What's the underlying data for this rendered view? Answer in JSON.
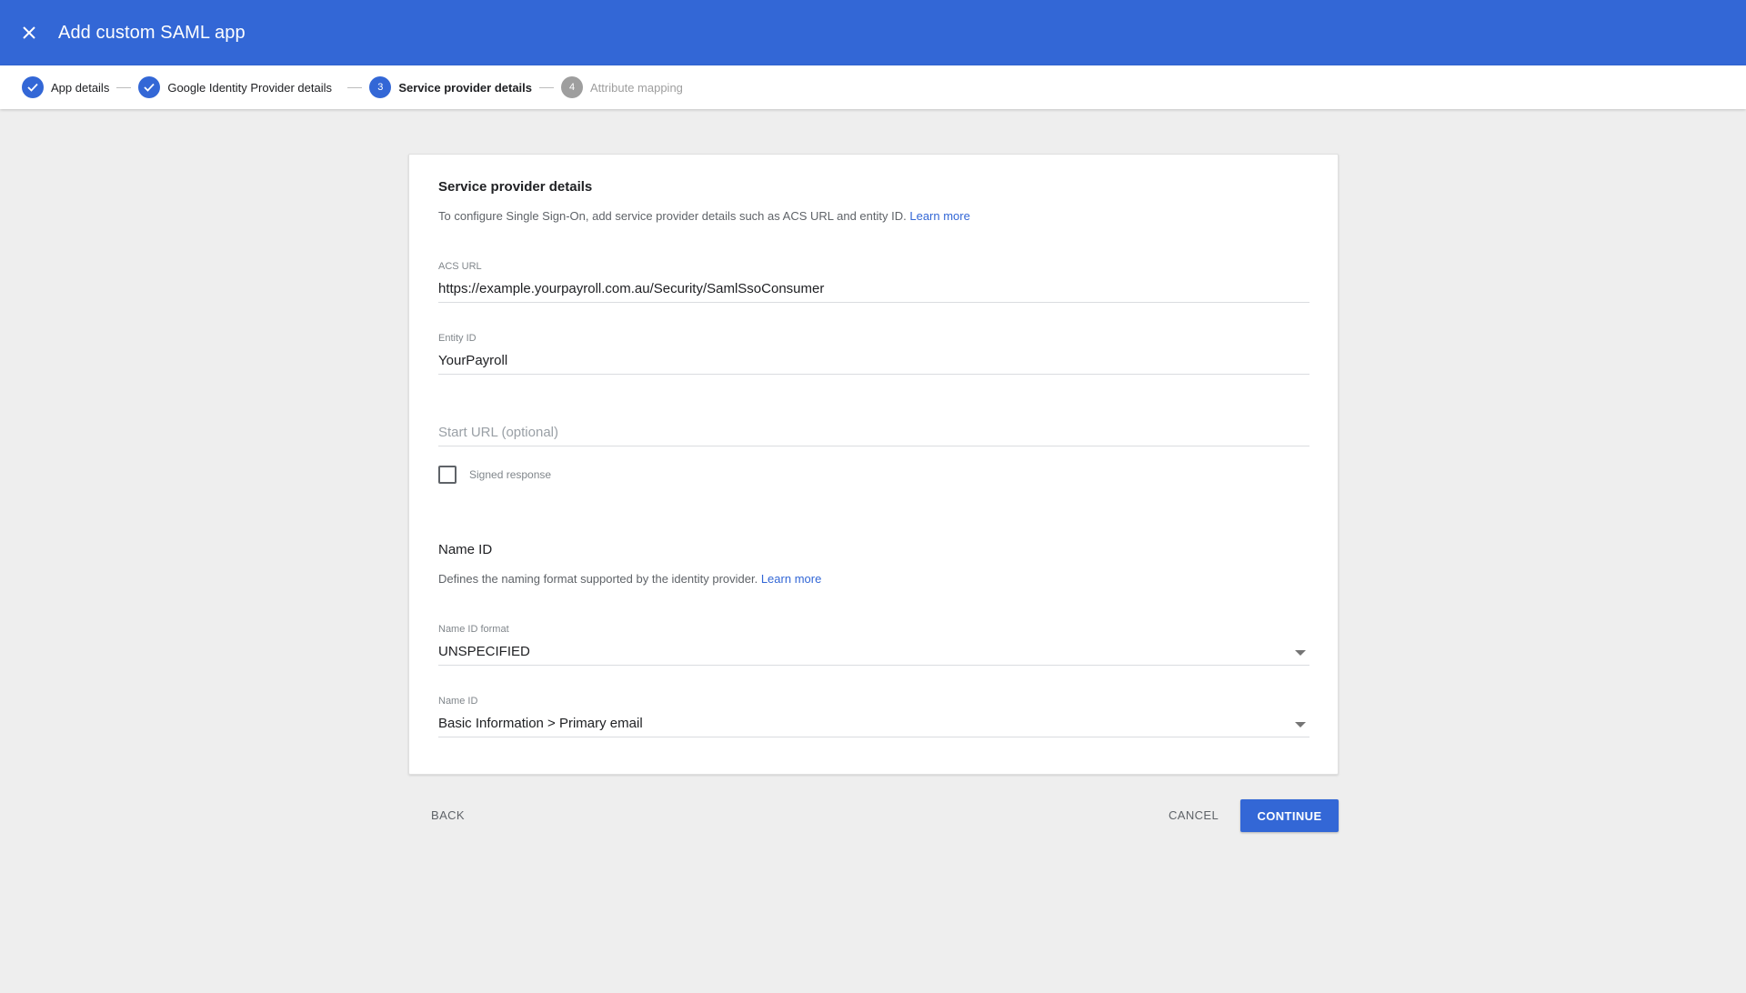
{
  "appbar": {
    "close_icon": "close-icon",
    "title": "Add custom SAML app",
    "color": "#3367d6"
  },
  "stepper": {
    "steps": [
      {
        "number": "1",
        "label": "App details",
        "state": "done"
      },
      {
        "number": "2",
        "label": "Google Identity Provider details",
        "state": "done"
      },
      {
        "number": "3",
        "label": "Service provider details",
        "state": "active"
      },
      {
        "number": "4",
        "label": "Attribute mapping",
        "state": "pending"
      }
    ]
  },
  "service_provider": {
    "title": "Service provider details",
    "description": "To configure Single Sign-On, add service provider details such as ACS URL and entity ID.",
    "learn_more": "Learn more",
    "acs_url": {
      "label": "ACS URL",
      "value": "https://example.yourpayroll.com.au/Security/SamlSsoConsumer"
    },
    "entity_id": {
      "label": "Entity ID",
      "value": "YourPayroll"
    },
    "start_url": {
      "placeholder": "Start URL (optional)",
      "value": ""
    },
    "signed_response": {
      "label": "Signed response",
      "checked": false
    }
  },
  "name_id": {
    "title": "Name ID",
    "description": "Defines the naming format supported by the identity provider.",
    "learn_more": "Learn more",
    "format": {
      "label": "Name ID format",
      "value": "UNSPECIFIED"
    },
    "name_id_field": {
      "label": "Name ID",
      "value": "Basic Information > Primary email"
    }
  },
  "footer": {
    "back": "BACK",
    "cancel": "CANCEL",
    "continue": "CONTINUE"
  }
}
